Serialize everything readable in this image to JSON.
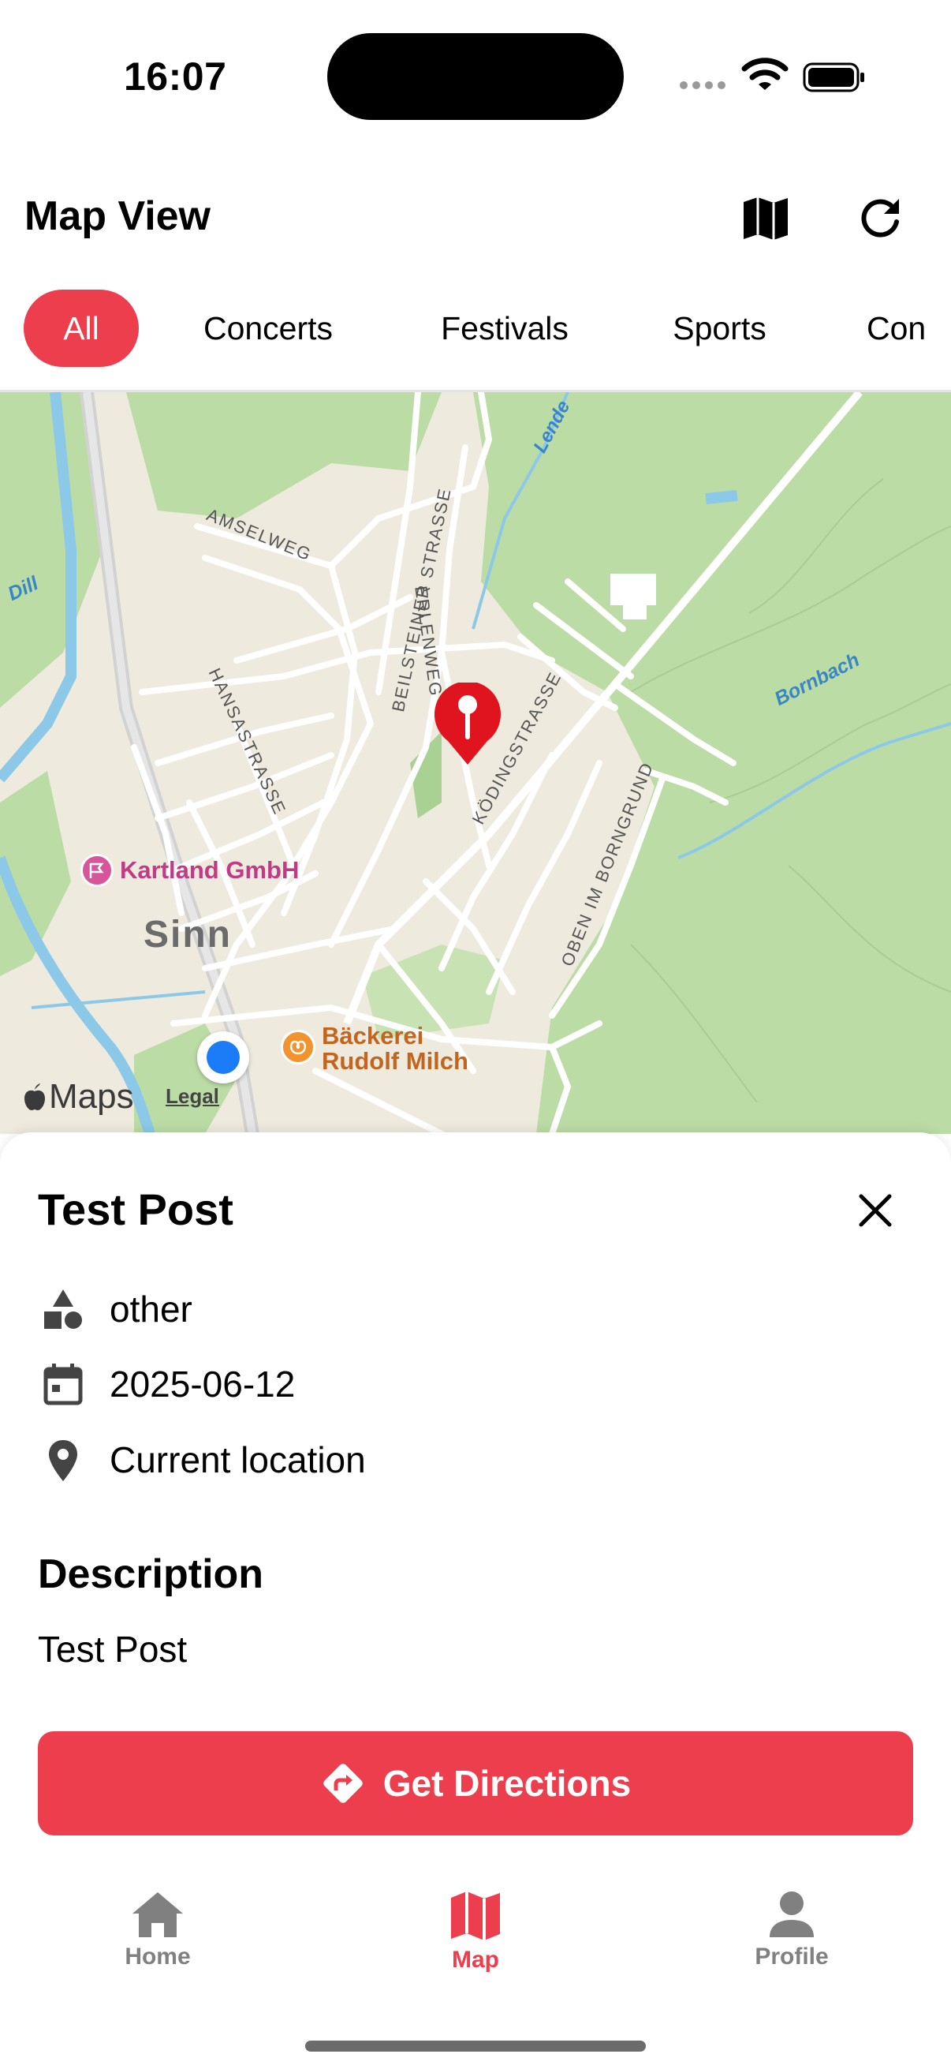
{
  "status_bar": {
    "time": "16:07"
  },
  "header": {
    "title": "Map View",
    "map_icon": "map-icon",
    "refresh_icon": "refresh-icon"
  },
  "filters": {
    "chips": [
      "All",
      "Concerts",
      "Festivals",
      "Sports",
      "Con"
    ],
    "selected": "All"
  },
  "map": {
    "streets": [
      "AMSELWEG",
      "BEILSTEINER STRASSE",
      "ERLENWEG",
      "HANSASTRASSE",
      "KÖDINGSTRASSE",
      "OBEN IM BORNGRUND"
    ],
    "water": [
      "Dill",
      "Lende",
      "Bornbach"
    ],
    "town": "Sinn",
    "pois": [
      "Kartland GmbH",
      "Bäckerei",
      "Rudolf Milch"
    ],
    "attribution": "Maps",
    "legal": "Legal",
    "colors": {
      "pin": "#e0141e",
      "user_location": "#1a7cf7",
      "park": "#bcdca6",
      "land": "#eeeade"
    }
  },
  "post": {
    "title": "Test Post",
    "category": "other",
    "date": "2025-06-12",
    "location": "Current location",
    "description_heading": "Description",
    "description": "Test Post",
    "directions_label": "Get Directions"
  },
  "tabbar": {
    "items": [
      {
        "label": "Home",
        "icon": "home-icon",
        "active": false
      },
      {
        "label": "Map",
        "icon": "map-icon",
        "active": true
      },
      {
        "label": "Profile",
        "icon": "person-icon",
        "active": false
      }
    ]
  },
  "colors": {
    "accent": "#ec3e4d",
    "inactive": "#808080"
  }
}
